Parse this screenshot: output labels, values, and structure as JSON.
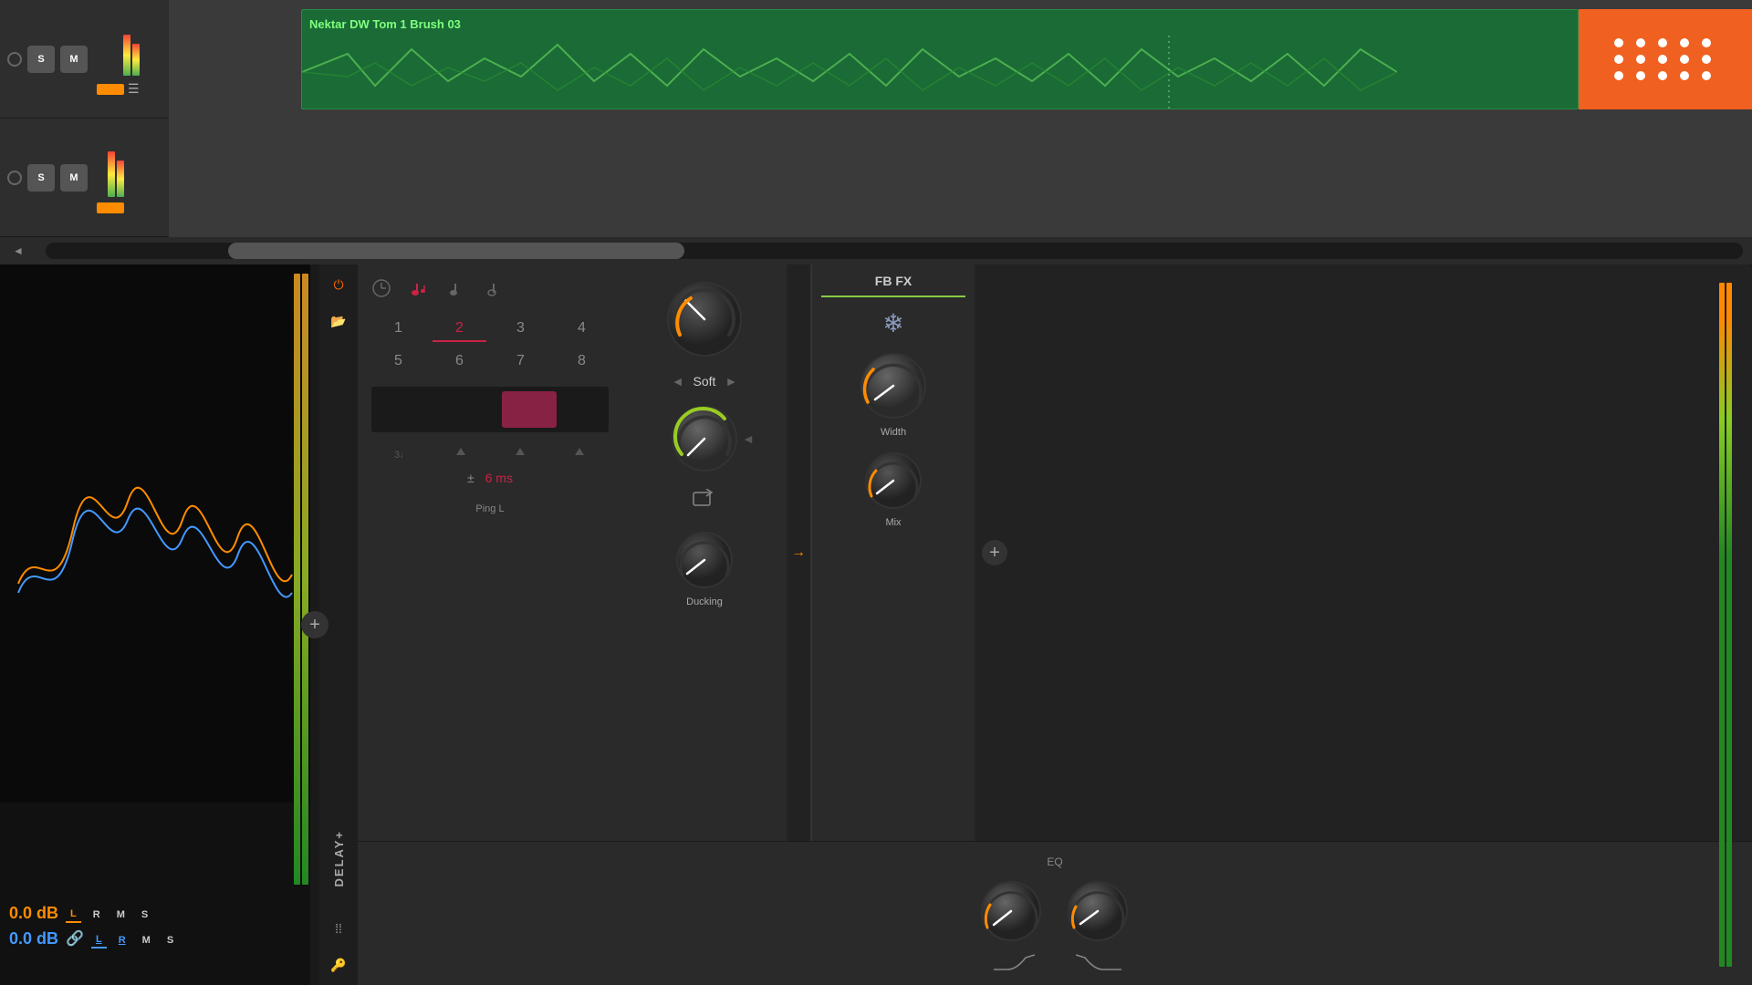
{
  "daw": {
    "track1": {
      "label": "Nektar DW Tom 1 Brush 03",
      "s_label": "S",
      "m_label": "M"
    },
    "track2": {
      "s_label": "S",
      "m_label": "M"
    }
  },
  "analyzer": {
    "level_orange": "0.0 dB",
    "level_blue": "0.0 dB",
    "ch1_labels": [
      "L",
      "R",
      "M",
      "S"
    ],
    "ch2_labels": [
      "L",
      "R",
      "M",
      "S"
    ]
  },
  "delay_plugin": {
    "name": "DELAY+",
    "power_icon": "⏻",
    "folder_icon": "📁",
    "dots_icon": "⁞⁞⁞",
    "key_icon": "🔑",
    "timing": {
      "icons": [
        "clock",
        "note-dotted",
        "note",
        "note-half"
      ],
      "numbers": [
        "1",
        "2",
        "3",
        "4",
        "5",
        "6",
        "7",
        "8"
      ],
      "active_number": "2",
      "ms_label": "6 ms",
      "ms_prefix": "±"
    },
    "eq": {
      "label": "EQ"
    },
    "channel": "Ping L"
  },
  "soft_section": {
    "label": "Soft",
    "prev_arrow": "◄",
    "next_arrow": "►",
    "knob1_angle": -40,
    "knob2_angle": -20,
    "knob2_label": "",
    "ducking_label": "Ducking",
    "loop_icon": "↩"
  },
  "fbfx_section": {
    "title": "FB FX",
    "freeze_icon": "❄",
    "width_label": "Width",
    "mix_label": "Mix",
    "knob_width_angle": -50,
    "knob_mix_angle": -60
  }
}
